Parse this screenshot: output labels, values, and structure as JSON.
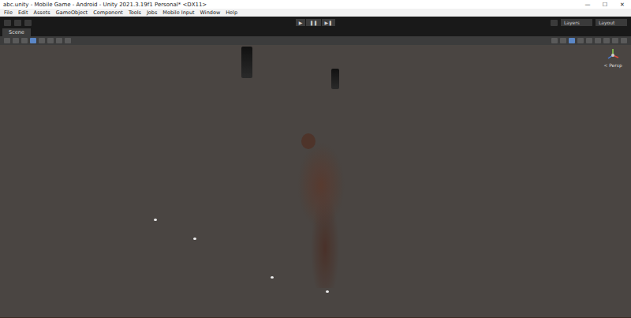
{
  "window": {
    "title": "abc.unity - Mobile Game - Android - Unity 2021.3.19f1 Personal* <DX11>"
  },
  "window_controls": [
    "—",
    "☐",
    "✕"
  ],
  "menu": [
    "File",
    "Edit",
    "Assets",
    "GameObject",
    "Component",
    "Tools",
    "Jobs",
    "Mobile Input",
    "Window",
    "Help"
  ],
  "play_controls": [
    {
      "label": "▶",
      "selected": false
    },
    {
      "label": "❚❚",
      "selected": false
    },
    {
      "label": "▶❚",
      "selected": false
    }
  ],
  "toolbar_right": [
    "Layers",
    "Layout"
  ],
  "tabs": [
    {
      "label": "Scene",
      "selected": true
    }
  ],
  "gizmo": {
    "label": "< Persp"
  }
}
